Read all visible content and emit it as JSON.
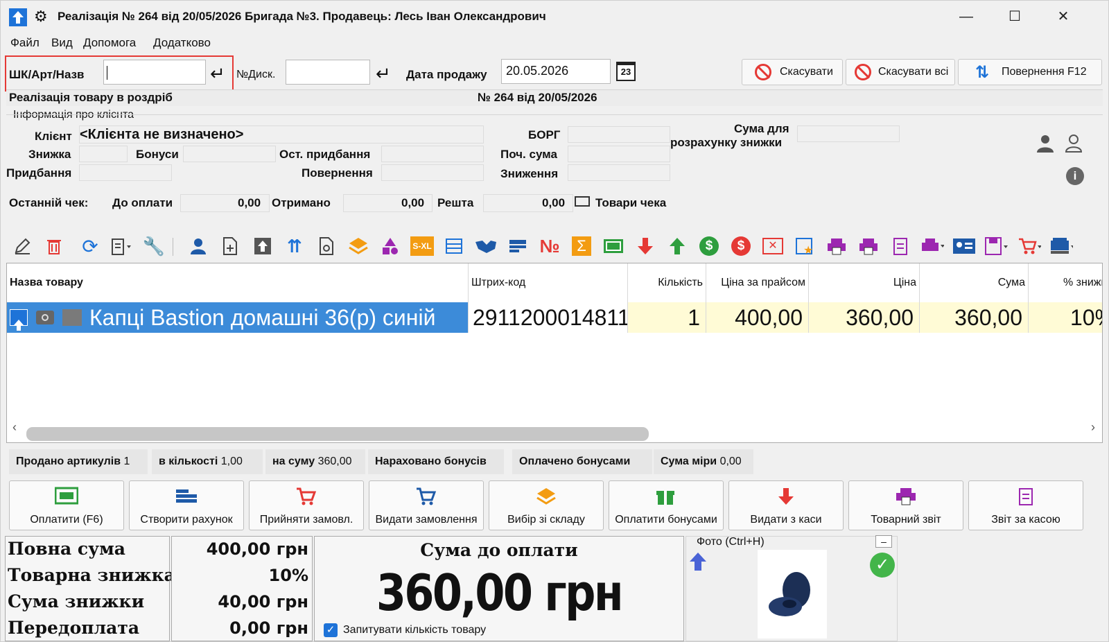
{
  "titlebar": {
    "title": "Реалізація № 264 від 20/05/2026 Бригада №3. Продавець: Лесь Іван Олександрович",
    "app_icon": "up-arrow-icon",
    "gear_icon": "gear-icon",
    "minimize": "—",
    "maximize": "☐",
    "close": "✕"
  },
  "menu": [
    "Файл",
    "Вид",
    "Допомога",
    "Додатково"
  ],
  "search": {
    "barcode_label": "ШК/Арт/Назв",
    "barcode_value": "",
    "disc_label": "№Диск.",
    "disc_value": "",
    "date_label": "Дата продажу",
    "date_value": "20.05.2026",
    "calendar_text": "23"
  },
  "actions": {
    "cancel": "Скасувати",
    "cancel_all": "Скасувати всі",
    "return": "Повернення F12"
  },
  "doc": {
    "type": "Реалізація товару в роздріб",
    "number": "№ 264 від 20/05/2026"
  },
  "client": {
    "section_title": "Інформація про клієнта",
    "client_label": "Клієнт",
    "client_value": "<Клієнта не визначено>",
    "discount_label": "Знижка",
    "bonus_label": "Бонуси",
    "last_purchase_label": "Ост. придбання",
    "purchase_label": "Придбання",
    "return_label": "Повернення",
    "debt_label": "БОРГ",
    "start_sum_label": "Поч. сума",
    "reduction_label": "Зниження",
    "discount_calc_label_1": "Сума для",
    "discount_calc_label_2": "розрахунку знижки"
  },
  "last_check": {
    "label": "Останній чек:",
    "to_pay_label": "До оплати",
    "to_pay": "0,00",
    "received_label": "Отримано",
    "received": "0,00",
    "change_label": "Решта",
    "change": "0,00",
    "items_label": "Товари чека"
  },
  "toolbar_icons": [
    "pencil-icon",
    "delete-icon",
    "refresh-icon",
    "clipboard-icon",
    "wrench-icon",
    "user-icon",
    "new-doc-icon",
    "upload-icon",
    "sort-icon",
    "doc-settings-icon",
    "layers-icon",
    "shapes-icon",
    "size-icon",
    "list-icon",
    "handshake-icon",
    "card-icon",
    "number-icon",
    "sum-icon",
    "cash-icon",
    "down-arrow-icon",
    "up-arrow-icon",
    "dollar-green-icon",
    "dollar-red-icon",
    "cancel-box-icon",
    "star-doc-icon",
    "print-icon",
    "print-2-icon",
    "report-icon",
    "printer-icon",
    "id-card-icon",
    "save-icon",
    "cart-icon",
    "pos-icon"
  ],
  "table": {
    "headers": [
      "Назва товару",
      "Штрих-код",
      "Кількість",
      "Ціна за прайсом",
      "Ціна",
      "Сума",
      "% знижк"
    ],
    "rows": [
      {
        "name": "Капці Bastion домашні 36(р) синій",
        "barcode": "2911200014811",
        "qty": "1",
        "list_price": "400,00",
        "price": "360,00",
        "sum": "360,00",
        "discount": "10%"
      }
    ]
  },
  "stats": {
    "sold_label": "Продано артикулів",
    "sold": "1",
    "qty_label": "в кількості",
    "qty": "1,00",
    "sum_label": "на суму",
    "sum": "360,00",
    "bonus_earned": "Нараховано бонусів",
    "bonus_paid": "Оплачено бонусами",
    "measure_label": "Сума міри",
    "measure": "0,00"
  },
  "buttons": [
    "Оплатити (F6)",
    "Створити рахунок",
    "Прийняти замовл.",
    "Видати замовлення",
    "Вибір зі складу",
    "Оплатити бонусами",
    "Видати з каси",
    "Товарний звіт",
    "Звіт за касою"
  ],
  "totals": {
    "full_label": "Повна сума",
    "full": "400,00 грн",
    "goods_disc_label": "Товарна знижка",
    "goods_disc": "10%",
    "disc_sum_label": "Сума знижки",
    "disc_sum": "40,00 грн",
    "prepay_label": "Передоплата",
    "prepay": "0,00 грн",
    "to_pay_title": "Сума до оплати",
    "to_pay": "360,00 грн",
    "ask_qty": "Запитувати кількість товару"
  },
  "photo": {
    "label": "Фото (Ctrl+H)",
    "collapse": "–"
  },
  "colors": {
    "accent": "#1e73d8",
    "selection": "#3c8bd9",
    "highlight_red": "#e53935",
    "yellow_cell": "#fffbd6"
  }
}
